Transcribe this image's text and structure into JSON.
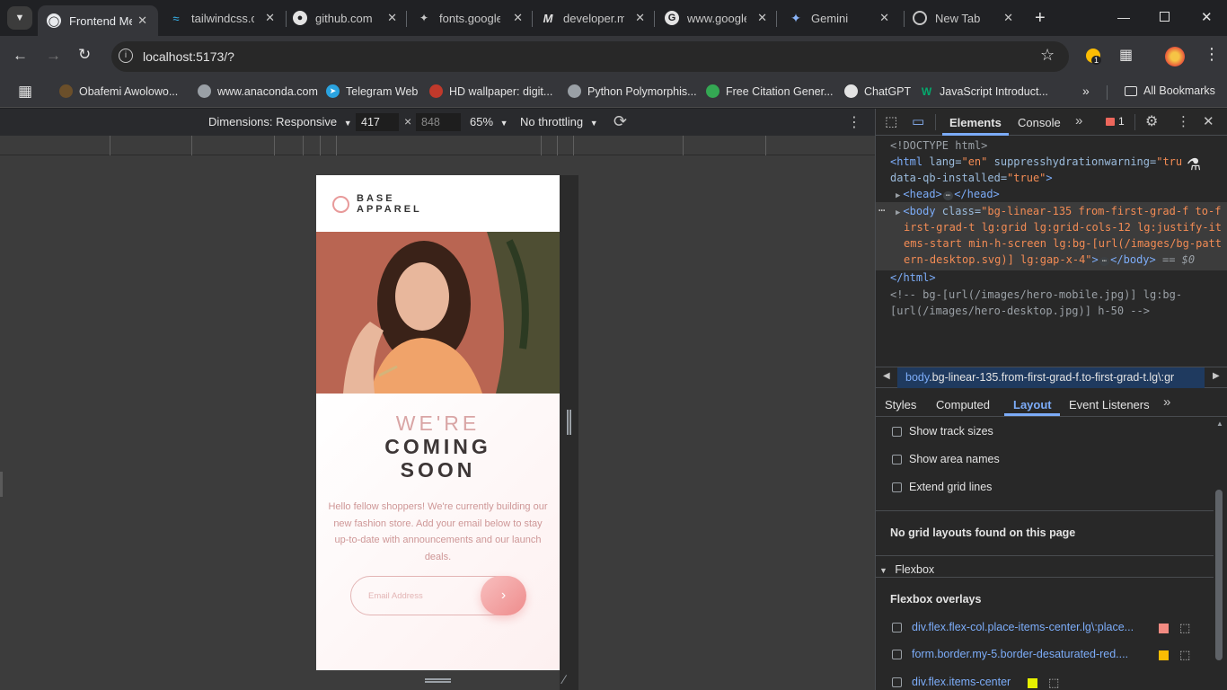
{
  "tabs": [
    {
      "title": "Frontend Me",
      "active": true
    },
    {
      "title": "tailwindcss.c"
    },
    {
      "title": "github.com"
    },
    {
      "title": "fonts.google"
    },
    {
      "title": "developer.m"
    },
    {
      "title": "www.google"
    },
    {
      "title": "Gemini"
    },
    {
      "title": "New Tab"
    }
  ],
  "address": "localhost:5173/?",
  "extension_badge": "1",
  "bookmarks": [
    "Obafemi Awolowo...",
    "www.anaconda.com",
    "Telegram Web",
    "HD wallpaper: digit...",
    "Python Polymorphis...",
    "Free Citation Gener...",
    "ChatGPT",
    "JavaScript Introduct..."
  ],
  "all_bookmarks": "All Bookmarks",
  "device": {
    "dimensions_label": "Dimensions: Responsive",
    "width": "417",
    "height": "848",
    "zoom": "65%",
    "throttling": "No throttling"
  },
  "mobile_page": {
    "logo_line1": "BASE",
    "logo_line2": "APPAREL",
    "heading_light": "WE'RE",
    "heading_bold1": "COMING",
    "heading_bold2": "SOON",
    "description": "Hello fellow shoppers! We're currently building our new fashion store. Add your email below to stay up-to-date with announcements and our launch deals.",
    "email_placeholder": "Email Address"
  },
  "devtools": {
    "tabs": {
      "elements": "Elements",
      "console": "Console",
      "issues_count": "1"
    },
    "dom": {
      "doctype": "<!DOCTYPE html>",
      "html_open_tag": "<html",
      "html_lang_attr": " lang=",
      "html_lang_val": "\"en\"",
      "html_shw_attr": " suppresshydrationwarning=",
      "html_shw_val": "\"tru",
      "html_qb_attr": "data-qb-installed=",
      "html_qb_val": "\"true\"",
      "html_close_bracket": ">",
      "head_open": "<head>",
      "head_close": "</head>",
      "body_open_tag": "<body",
      "body_class_attr": " class=",
      "body_class_1": "\"bg-linear-135 from-first-grad-f to-f",
      "body_class_2": "irst-grad-t lg:grid lg:grid-cols-12 lg:justify-it",
      "body_class_3": "ems-start min-h-screen lg:bg-[url(/images/bg-patt",
      "body_class_4": "ern-desktop.svg)] lg:gap-x-4\"",
      "body_tail_bracket": ">",
      "body_close": "</body>",
      "eq_marker": " == $0",
      "html_close": "</html>",
      "comment_1": "<!-- bg-[url(/images/hero-mobile.jpg)] lg:bg-",
      "comment_2": "[url(/images/hero-desktop.jpg)] h-50 -->"
    },
    "breadcrumb_tag": "body",
    "breadcrumb_rest": ".bg-linear-135.from-first-grad-f.to-first-grad-t.lg\\:gr",
    "subtabs": [
      "Styles",
      "Computed",
      "Layout",
      "Event Listeners"
    ],
    "active_subtab": "Layout",
    "layout": {
      "show_track_sizes": "Show track sizes",
      "show_area_names": "Show area names",
      "extend_grid_lines": "Extend grid lines",
      "no_grid": "No grid layouts found on this page",
      "flexbox_section": "Flexbox",
      "flexbox_overlays": "Flexbox overlays",
      "flex_items": [
        {
          "label": "div.flex.flex-col.place-items-center.lg\\:place...",
          "color": "#f28b82"
        },
        {
          "label": "form.border.my-5.border-desaturated-red....",
          "color": "#fbbc04"
        },
        {
          "label": "div.flex.items-center",
          "color": "#e6f000"
        }
      ]
    }
  }
}
